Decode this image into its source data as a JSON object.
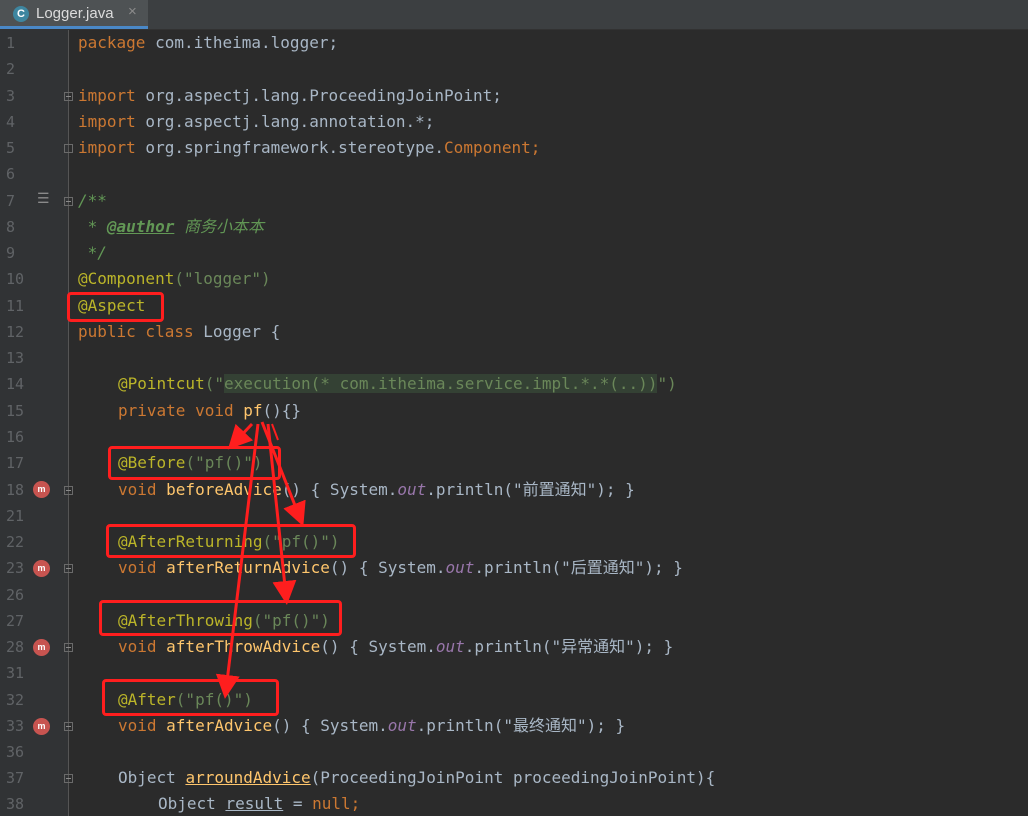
{
  "tab": {
    "title": "Logger.java",
    "icon": "java-class-icon",
    "close": "×"
  },
  "lines": [
    {
      "n": "1"
    },
    {
      "n": "2"
    },
    {
      "n": "3"
    },
    {
      "n": "4"
    },
    {
      "n": "5"
    },
    {
      "n": "6"
    },
    {
      "n": "7"
    },
    {
      "n": "8"
    },
    {
      "n": "9"
    },
    {
      "n": "10"
    },
    {
      "n": "11"
    },
    {
      "n": "12"
    },
    {
      "n": "13"
    },
    {
      "n": "14"
    },
    {
      "n": "15"
    },
    {
      "n": "16"
    },
    {
      "n": "17"
    },
    {
      "n": "18"
    },
    {
      "n": "21"
    },
    {
      "n": "22"
    },
    {
      "n": "23"
    },
    {
      "n": "26"
    },
    {
      "n": "27"
    },
    {
      "n": "28"
    },
    {
      "n": "31"
    },
    {
      "n": "32"
    },
    {
      "n": "33"
    },
    {
      "n": "36"
    },
    {
      "n": "37"
    },
    {
      "n": "38"
    }
  ],
  "code": {
    "l1_kw": "package",
    "l1_rest": " com.itheima.logger;",
    "l3_kw": "import",
    "l3_rest": " org.aspectj.lang.ProceedingJoinPoint;",
    "l4_kw": "import",
    "l4_rest": " org.aspectj.lang.annotation.*;",
    "l5_kw": "import",
    "l5_rest": " org.springframework.stereotype.",
    "l5_cls": "Component",
    "l5_end": ";",
    "l7": "/**",
    "l8_star": " * ",
    "l8_tag": "@author",
    "l8_text": " 商务小本本",
    "l9": " */",
    "l10_ann": "@Component",
    "l10_str": "(\"logger\")",
    "l11_ann": "@Aspect",
    "l12_kw": "public class",
    "l12_rest": " Logger {",
    "l14_ann": "@Pointcut",
    "l14_p1": "(\"",
    "l14_str": "execution(* com.itheima.service.impl.*.*(..))",
    "l14_p2": "\")",
    "l15_kw": "private void",
    "l15_fn": " pf",
    "l15_rest": "(){}",
    "l17_ann": "@Before",
    "l17_str": "(\"pf()\")",
    "l18_kw": "void",
    "l18_fn": " beforeAdvice",
    "l18_rest": "() { System.",
    "l18_out": "out",
    "l18_end": ".println(\"前置通知\"); }",
    "l22_ann": "@AfterReturning",
    "l22_str": "(\"pf()\")",
    "l23_kw": "void",
    "l23_fn": " afterReturnAdvice",
    "l23_rest": "() { System.",
    "l23_out": "out",
    "l23_end": ".println(\"后置通知\"); }",
    "l27_ann": "@AfterThrowing",
    "l27_str": "(\"pf()\")",
    "l28_kw": "void",
    "l28_fn": " afterThrowAdvice",
    "l28_rest": "() { System.",
    "l28_out": "out",
    "l28_end": ".println(\"异常通知\"); }",
    "l32_ann": "@After",
    "l32_str": "(\"pf()\")",
    "l33_kw": "void",
    "l33_fn": " afterAdvice",
    "l33_rest": "() { System.",
    "l33_out": "out",
    "l33_end": ".println(\"最终通知\"); }",
    "l37_a": "Object ",
    "l37_fn": "arroundAdvice",
    "l37_rest": "(ProceedingJoinPoint proceedingJoinPoint){",
    "l38_a": "Object ",
    "l38_var": "result",
    "l38_eq": " = ",
    "l38_null": "null",
    "l38_end": ";"
  },
  "gutter_icons": {
    "advice": "m",
    "aspect": "@"
  }
}
